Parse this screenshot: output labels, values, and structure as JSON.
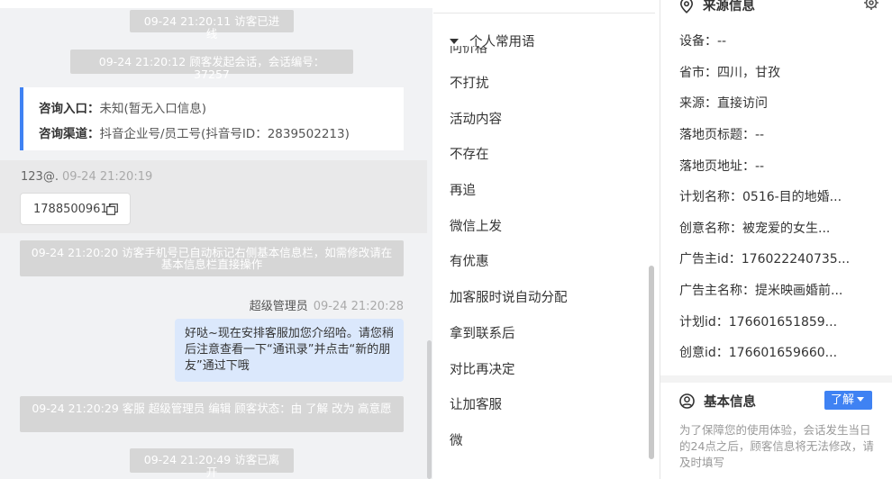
{
  "chat": {
    "sys_entered": "09-24 21:20:11 访客已进线",
    "sys_session": "09-24 21:20:12 顾客发起会话，会话编号：37257",
    "consult": {
      "entry_label": "咨询入口：",
      "entry_value": "未知(暂无入口信息)",
      "channel_label": "咨询渠道：",
      "channel_value": "抖音企业号/员工号(抖音号ID：2839502213)"
    },
    "incoming": {
      "sender": "123@.",
      "time": "09-24 21:20:19",
      "phone": "17885009616"
    },
    "sys_phone_note": "09-24 21:20:20 访客手机号已自动标记右侧基本信息栏，如需修改请在基本信息栏直接操作",
    "outgoing": {
      "sender": "超级管理员",
      "time": "09-24 21:20:28",
      "text": "好哒~现在安排客服加您介绍哈。请您稍后注意查看一下“通讯录”并点击“新的朋友”通过下哦"
    },
    "sys_status": "09-24 21:20:29 客服 超级管理员 编辑 顾客状态：由 了解 改为 高意愿",
    "sys_left": "09-24 21:20:49 访客已离开"
  },
  "phrases": {
    "title": "个人常用语",
    "partial_item": "问价格",
    "items": [
      "不打扰",
      "活动内容",
      "不存在",
      "再追",
      "微信上发",
      "有优惠",
      "加客服时说自动分配",
      "拿到联系后",
      "对比再决定",
      "让加客服",
      "微"
    ]
  },
  "source_info": {
    "title": "来源信息",
    "rows": [
      "设备：--",
      "省市：四川，甘孜",
      "来源：直接访问",
      "落地页标题：--",
      "落地页地址：--",
      "计划名称：0516-目的地婚...",
      "创意名称：被宠爱的女生...",
      "广告主id：176022240735...",
      "广告主名称：提米映画婚前...",
      "计划id：176601651859...",
      "创意id：176601659660..."
    ]
  },
  "basic_info": {
    "title": "基本信息",
    "status_button": "了解",
    "notice": "为了保障您的使用体验，会话发生当日的24点之后，顾客信息将无法修改，请及时填写"
  },
  "colors": {
    "accent": "#3f82f3",
    "system_msg_bg": "#d6d6d6",
    "out_bubble": "#dbe8fc",
    "chat_bg": "#f1f2f4"
  },
  "icons": [
    "copy-icon",
    "caret-down-icon",
    "location-pin-icon",
    "gear-icon",
    "user-circle-icon",
    "chevron-down-icon"
  ]
}
